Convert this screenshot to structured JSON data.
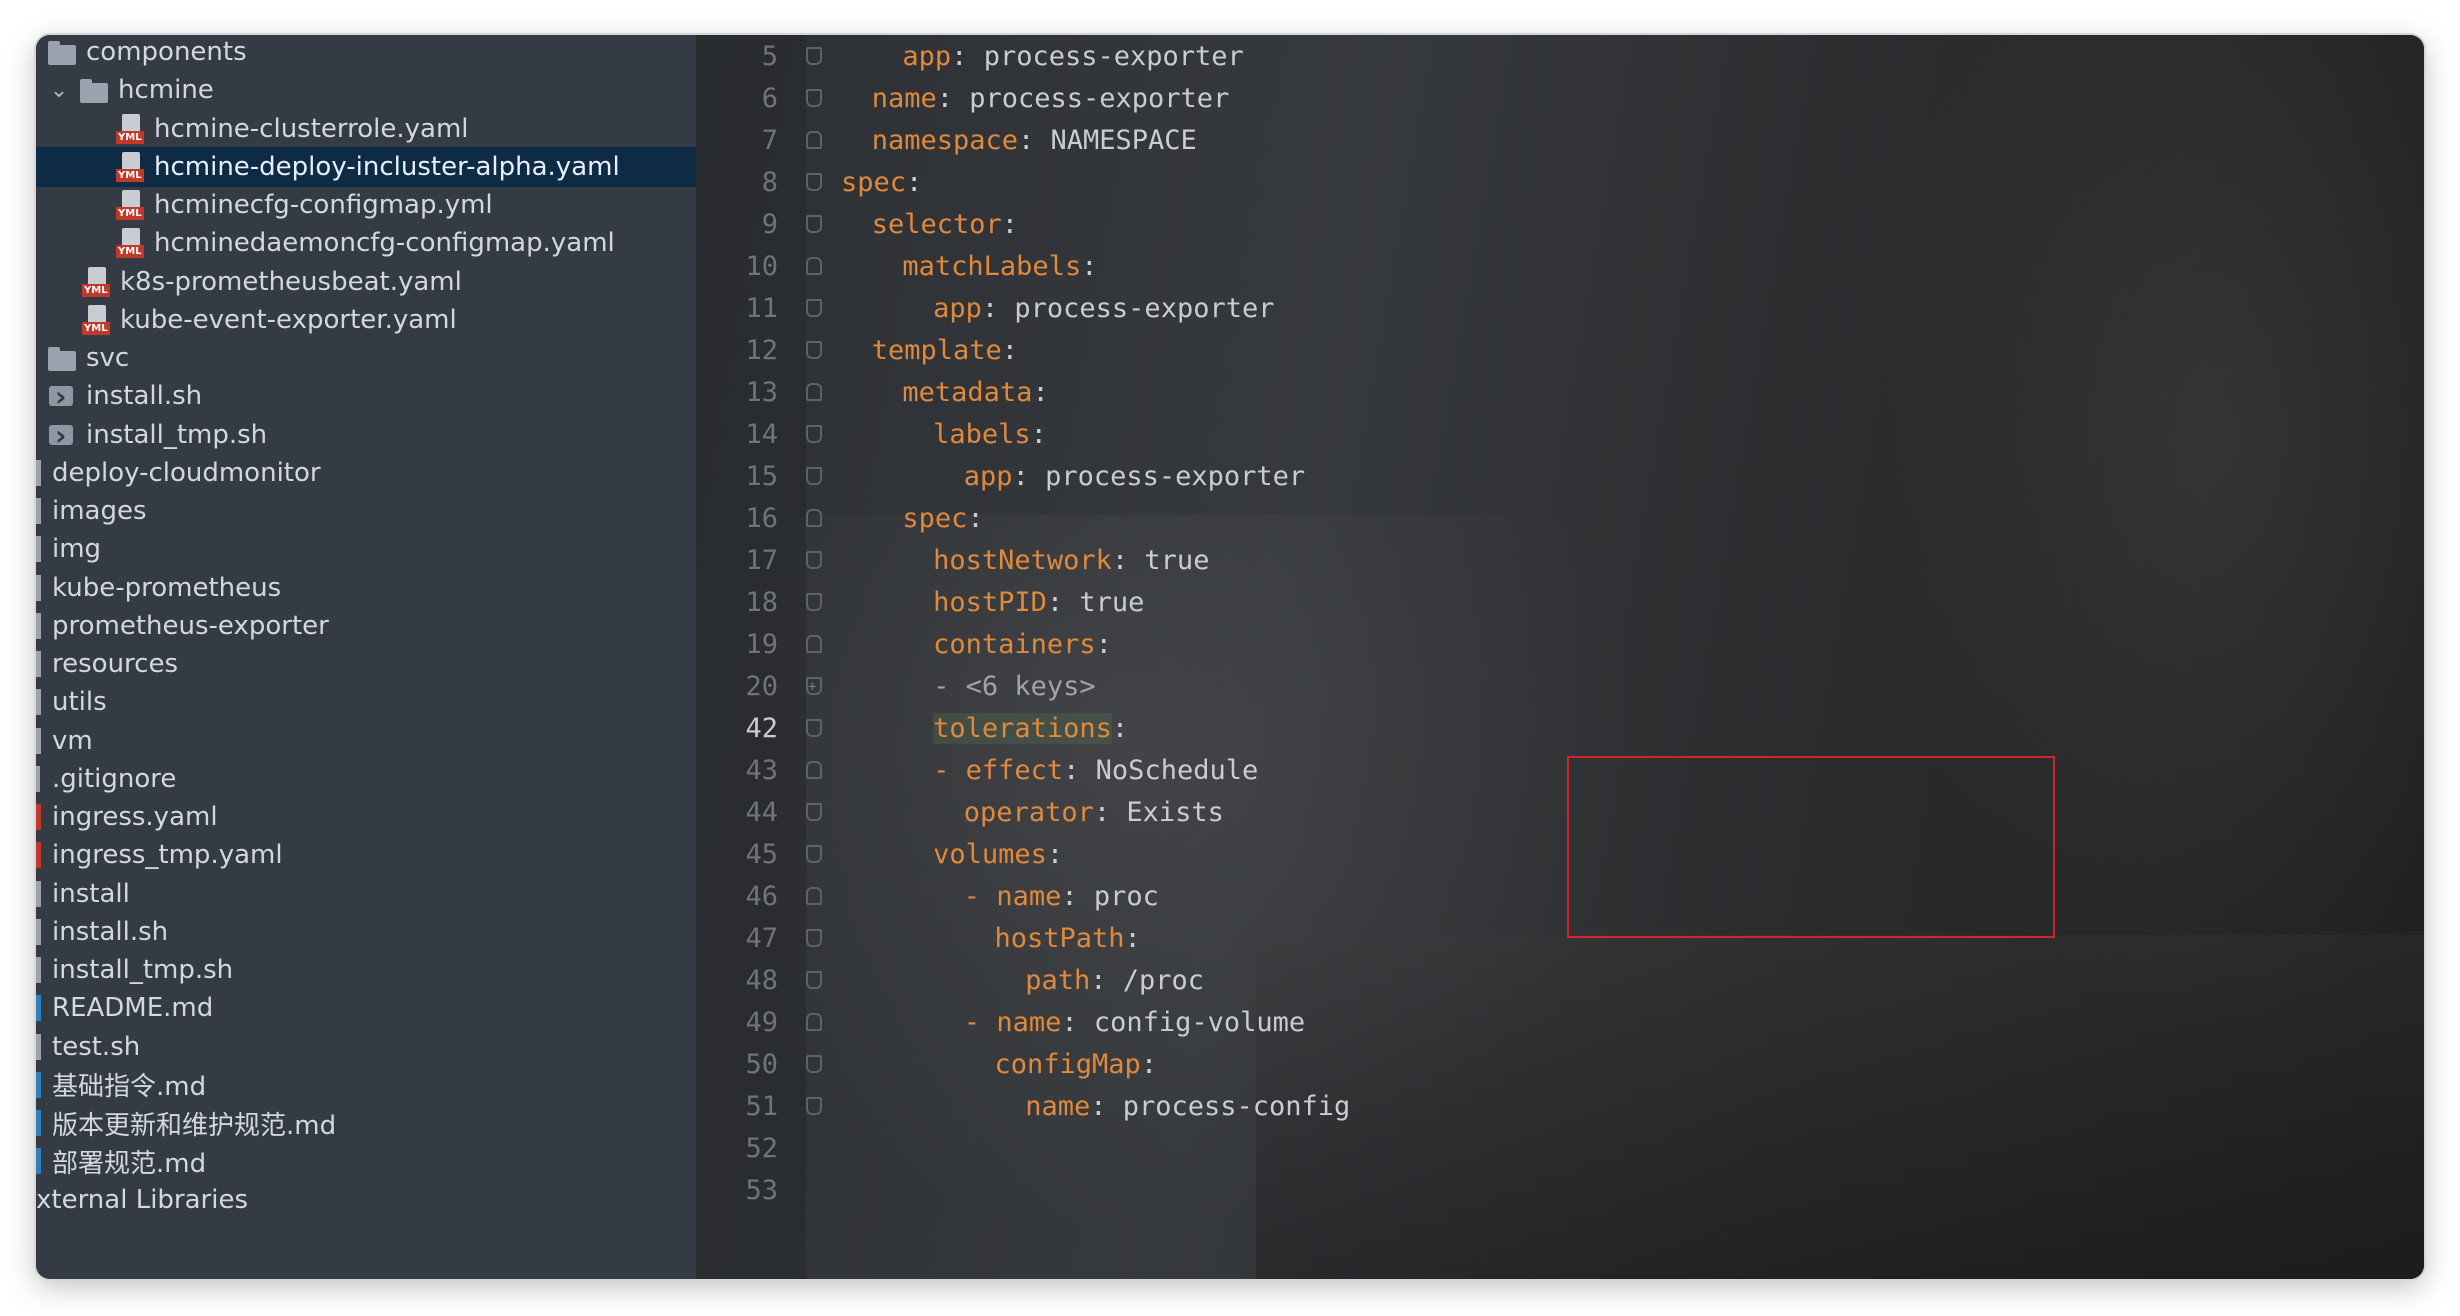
{
  "sidebar": {
    "rows": [
      {
        "label": "components",
        "icon": "folder-icon",
        "indent": 0,
        "chevron": false
      },
      {
        "label": "hcmine",
        "icon": "folder-icon",
        "indent": 0,
        "chevron": true
      },
      {
        "label": "hcmine-clusterrole.yaml",
        "icon": "yml-file-icon",
        "indent": 2
      },
      {
        "label": "hcmine-deploy-incluster-alpha.yaml",
        "icon": "yml-file-icon",
        "indent": 2,
        "selected": true
      },
      {
        "label": "hcminecfg-configmap.yml",
        "icon": "yml-file-icon",
        "indent": 2
      },
      {
        "label": "hcminedaemoncfg-configmap.yaml",
        "icon": "yml-file-icon",
        "indent": 2
      },
      {
        "label": "k8s-prometheusbeat.yaml",
        "icon": "yml-file-icon",
        "indent": 1
      },
      {
        "label": "kube-event-exporter.yaml",
        "icon": "yml-file-icon",
        "indent": 1
      },
      {
        "label": "svc",
        "icon": "folder-icon",
        "indent": 0
      },
      {
        "label": "install.sh",
        "icon": "shell-file-icon",
        "indent": 0
      },
      {
        "label": "install_tmp.sh",
        "icon": "shell-file-icon",
        "indent": 0
      },
      {
        "label": "deploy-cloudmonitor",
        "icon": "folder-bar-icon",
        "indent": -1
      },
      {
        "label": "images",
        "icon": "folder-bar-icon",
        "indent": -1
      },
      {
        "label": "img",
        "icon": "folder-bar-icon",
        "indent": -1
      },
      {
        "label": "kube-prometheus",
        "icon": "folder-bar-icon",
        "indent": -1
      },
      {
        "label": "prometheus-exporter",
        "icon": "folder-bar-icon",
        "indent": -1
      },
      {
        "label": "resources",
        "icon": "folder-bar-icon",
        "indent": -1
      },
      {
        "label": "utils",
        "icon": "folder-bar-icon",
        "indent": -1
      },
      {
        "label": "vm",
        "icon": "folder-bar-icon",
        "indent": -1
      },
      {
        "label": ".gitignore",
        "icon": "gitignore-icon",
        "indent": -1
      },
      {
        "label": "ingress.yaml",
        "icon": "yml-bar-icon",
        "indent": -1
      },
      {
        "label": "ingress_tmp.yaml",
        "icon": "yml-bar-icon",
        "indent": -1
      },
      {
        "label": "install",
        "icon": "file-bar-icon",
        "indent": -1
      },
      {
        "label": "install.sh",
        "icon": "shell-bar-icon",
        "indent": -1
      },
      {
        "label": "install_tmp.sh",
        "icon": "shell-bar-icon",
        "indent": -1
      },
      {
        "label": "README.md",
        "icon": "markdown-bar-icon",
        "indent": -1
      },
      {
        "label": "test.sh",
        "icon": "shell-bar-icon",
        "indent": -1
      },
      {
        "label": "基础指令.md",
        "icon": "markdown-bar-icon",
        "indent": -1
      },
      {
        "label": "版本更新和维护规范.md",
        "icon": "markdown-bar-icon",
        "indent": -1
      },
      {
        "label": "部署规范.md",
        "icon": "markdown-bar-icon",
        "indent": -1
      },
      {
        "label": "xternal Libraries",
        "icon": "none",
        "indent": -2
      }
    ]
  },
  "editor": {
    "lines": [
      {
        "num": "5",
        "indent": 2,
        "key": "app",
        "value": "process-exporter"
      },
      {
        "num": "6",
        "indent": 1,
        "key": "name",
        "value": "process-exporter"
      },
      {
        "num": "7",
        "indent": 1,
        "key": "namespace",
        "value": "NAMESPACE"
      },
      {
        "num": "8",
        "indent": 0,
        "key": "spec",
        "value": ""
      },
      {
        "num": "9",
        "indent": 1,
        "key": "selector",
        "value": ""
      },
      {
        "num": "10",
        "indent": 2,
        "key": "matchLabels",
        "value": ""
      },
      {
        "num": "11",
        "indent": 3,
        "key": "app",
        "value": "process-exporter"
      },
      {
        "num": "12",
        "indent": 1,
        "key": "template",
        "value": ""
      },
      {
        "num": "13",
        "indent": 2,
        "key": "metadata",
        "value": ""
      },
      {
        "num": "14",
        "indent": 3,
        "key": "labels",
        "value": ""
      },
      {
        "num": "15",
        "indent": 4,
        "key": "app",
        "value": "process-exporter"
      },
      {
        "num": "16",
        "indent": 2,
        "key": "spec",
        "value": ""
      },
      {
        "num": "17",
        "indent": 3,
        "key": "hostNetwork",
        "value": "true"
      },
      {
        "num": "18",
        "indent": 3,
        "key": "hostPID",
        "value": "true"
      },
      {
        "num": "19",
        "indent": 3,
        "key": "containers",
        "value": ""
      },
      {
        "num": "20",
        "indent": 3,
        "folded": "- <6 keys>"
      },
      {
        "num": "42",
        "indent": 3,
        "key": "tolerations",
        "value": "",
        "current": true
      },
      {
        "num": "43",
        "indent": 3,
        "dash": true,
        "key": "effect",
        "value": "NoSchedule"
      },
      {
        "num": "44",
        "indent": 4,
        "key": "operator",
        "value": "Exists"
      },
      {
        "num": "45",
        "indent": 3,
        "key": "volumes",
        "value": ""
      },
      {
        "num": "46",
        "indent": 4,
        "dash": true,
        "key": "name",
        "value": "proc"
      },
      {
        "num": "47",
        "indent": 5,
        "key": "hostPath",
        "value": ""
      },
      {
        "num": "48",
        "indent": 6,
        "key": "path",
        "value": "/proc"
      },
      {
        "num": "49",
        "indent": 4,
        "dash": true,
        "key": "name",
        "value": "config-volume"
      },
      {
        "num": "50",
        "indent": 5,
        "key": "configMap",
        "value": ""
      },
      {
        "num": "51",
        "indent": 6,
        "key": "name",
        "value": "process-config"
      },
      {
        "num": "52",
        "indent": 0,
        "key": "",
        "value": ""
      },
      {
        "num": "53",
        "indent": 0,
        "key": "",
        "value": ""
      }
    ]
  },
  "colors": {
    "key": "#e0893b",
    "value": "#c9ccd1",
    "highlight_box": "#d6232a",
    "selection": "#0e2b46"
  }
}
